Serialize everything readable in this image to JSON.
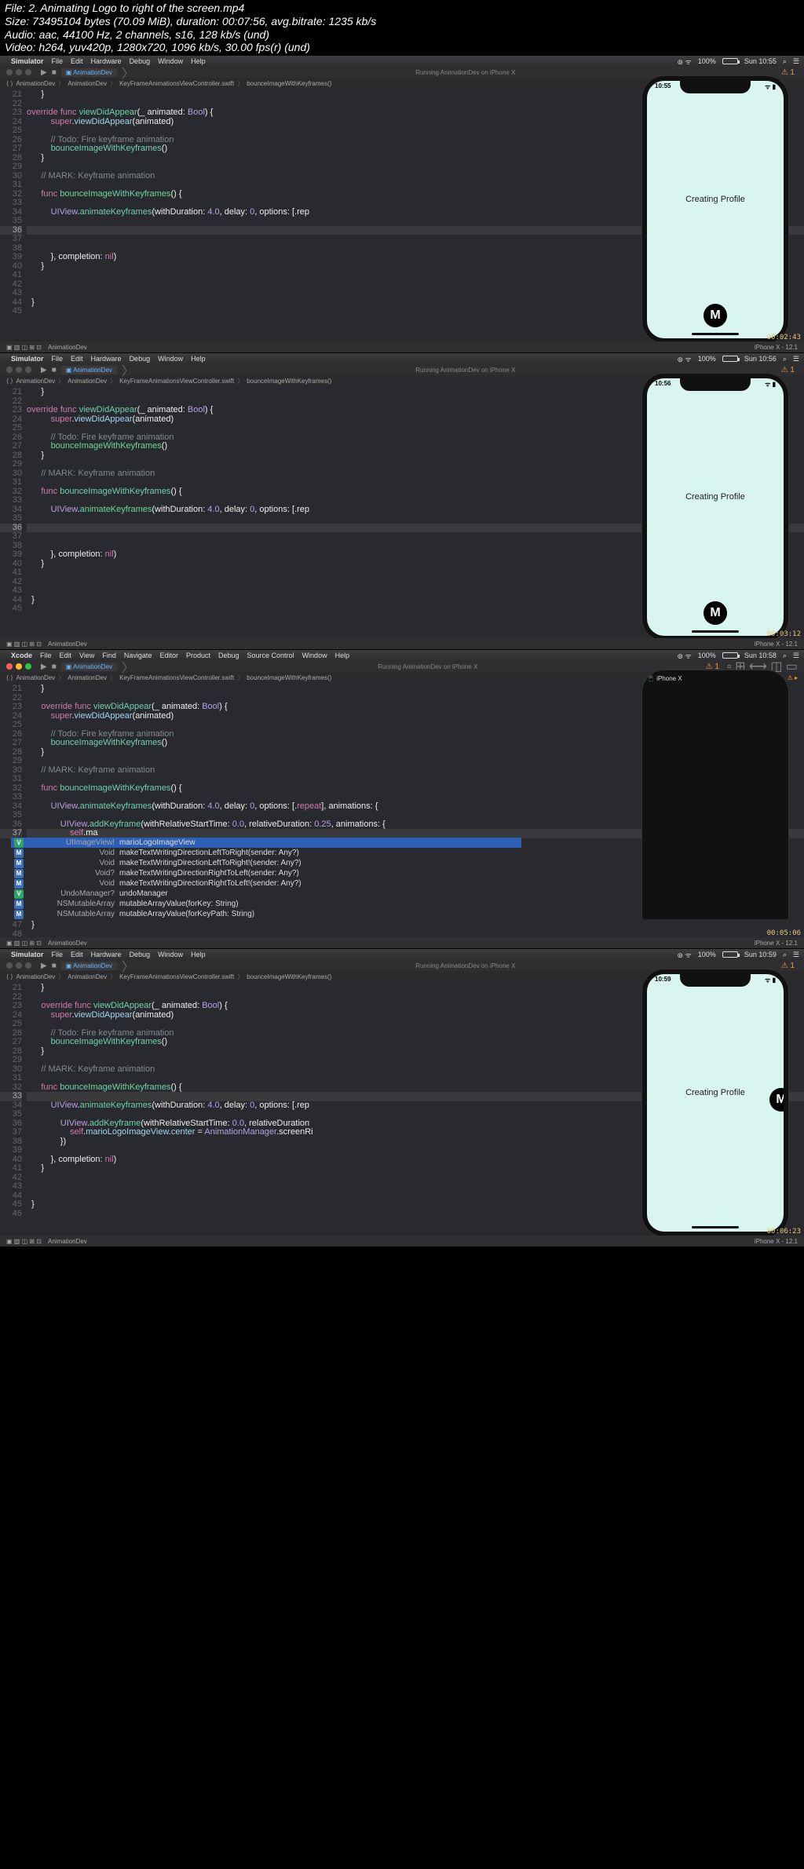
{
  "video_info": {
    "file": "File: 2. Animating Logo to right of the screen.mp4",
    "size": "Size: 73495104 bytes (70.09 MiB), duration: 00:07:56, avg.bitrate: 1235 kb/s",
    "audio": "Audio: aac, 44100 Hz, 2 channels, s16, 128 kb/s (und)",
    "video": "Video: h264, yuv420p, 1280x720, 1096 kb/s, 30.00 fps(r) (und)"
  },
  "menubar": {
    "app_sim": "Simulator",
    "app_xcode": "Xcode",
    "sim_items": [
      "File",
      "Edit",
      "Hardware",
      "Debug",
      "Window",
      "Help"
    ],
    "xcode_items": [
      "File",
      "Edit",
      "View",
      "Find",
      "Navigate",
      "Editor",
      "Product",
      "Debug",
      "Source Control",
      "Window",
      "Help"
    ],
    "battery": "100%",
    "day": "Sun"
  },
  "toolbar": {
    "scheme": "AnimationDev",
    "device": "iPhone X",
    "status": "Running AnimationDev on iPhone X"
  },
  "path": {
    "segs": [
      "AnimationDev",
      "AnimationDev",
      "KeyFrameAnimationsViewController.swift",
      "bounceImageWithKeyframes()"
    ]
  },
  "code_common": {
    "lines": [
      {
        "n": 21,
        "t": "      }"
      },
      {
        "n": 22,
        "t": ""
      },
      {
        "n": 23,
        "t": "      override func viewDidAppear(_ animated: Bool) {",
        "tok": [
          "kw:override",
          " ",
          "kw:func",
          " ",
          "fn:viewDidAppear",
          "pu:(",
          "id:_ animated: ",
          "ty:Bool",
          "pu:) {"
        ]
      },
      {
        "n": 24,
        "t": "          super.viewDidAppear(animated)",
        "tok": [
          "          ",
          "kw:super",
          "pu:.",
          "pr:viewDidAppear",
          "pu:(animated)"
        ]
      },
      {
        "n": 25,
        "t": ""
      },
      {
        "n": 26,
        "t": "          // Todo: Fire keyframe animation",
        "tok": [
          "          ",
          "cm:// Todo: Fire keyframe animation"
        ]
      },
      {
        "n": 27,
        "t": "          bounceImageWithKeyframes()",
        "tok": [
          "          ",
          "fn:bounceImageWithKeyframes",
          "pu:()"
        ]
      },
      {
        "n": 28,
        "t": "      }"
      },
      {
        "n": 29,
        "t": ""
      },
      {
        "n": 30,
        "t": "      // MARK: Keyframe animation",
        "tok": [
          "      ",
          "cm:// MARK: Keyframe animation"
        ]
      },
      {
        "n": 31,
        "t": ""
      },
      {
        "n": 32,
        "t": "      func bounceImageWithKeyframes() {",
        "tok": [
          "      ",
          "kw:func",
          " ",
          "fn:bounceImageWithKeyframes",
          "pu:() {"
        ]
      },
      {
        "n": 33,
        "t": ""
      },
      {
        "n": 34,
        "t": "          UIView.animateKeyframes(withDuration: 4.0, delay: 0, options: [.rep",
        "tok": [
          "          ",
          "ty:UIView",
          "pu:.",
          "fn:animateKeyframes",
          "pu:(withDuration: ",
          "nm:4.0",
          "pu:, delay: ",
          "nm:0",
          "pu:, options: [.",
          "id:rep"
        ]
      },
      {
        "n": 35,
        "t": ""
      },
      {
        "n": 36,
        "t": "",
        "hl": true
      },
      {
        "n": 37,
        "t": ""
      },
      {
        "n": 38,
        "t": ""
      },
      {
        "n": 39,
        "t": "          }, completion: nil)",
        "tok": [
          "          ",
          "pu:}, completion: ",
          "kw:nil",
          "pu:)"
        ]
      },
      {
        "n": 40,
        "t": "      }"
      },
      {
        "n": 41,
        "t": ""
      },
      {
        "n": 42,
        "t": ""
      },
      {
        "n": 43,
        "t": ""
      },
      {
        "n": 44,
        "t": "  }"
      },
      {
        "n": 45,
        "t": ""
      }
    ]
  },
  "code_frame3": {
    "lines": [
      {
        "n": 21,
        "t": "      }"
      },
      {
        "n": 22,
        "t": ""
      },
      {
        "n": 23,
        "tok": [
          "      ",
          "kw:override",
          " ",
          "kw:func",
          " ",
          "fn:viewDidAppear",
          "pu:(",
          "id:_ animated: ",
          "ty:Bool",
          "pu:) {"
        ]
      },
      {
        "n": 24,
        "tok": [
          "          ",
          "kw:super",
          "pu:.",
          "pr:viewDidAppear",
          "pu:(animated)"
        ]
      },
      {
        "n": 25,
        "t": ""
      },
      {
        "n": 26,
        "tok": [
          "          ",
          "cm:// Todo: Fire keyframe animation"
        ]
      },
      {
        "n": 27,
        "tok": [
          "          ",
          "fn:bounceImageWithKeyframes",
          "pu:()"
        ]
      },
      {
        "n": 28,
        "t": "      }"
      },
      {
        "n": 29,
        "t": ""
      },
      {
        "n": 30,
        "tok": [
          "      ",
          "cm:// MARK: Keyframe animation"
        ]
      },
      {
        "n": 31,
        "t": ""
      },
      {
        "n": 32,
        "tok": [
          "      ",
          "kw:func",
          " ",
          "fn:bounceImageWithKeyframes",
          "pu:() {"
        ]
      },
      {
        "n": 33,
        "t": ""
      },
      {
        "n": 34,
        "tok": [
          "          ",
          "ty:UIView",
          "pu:.",
          "fn:animateKeyframes",
          "pu:(withDuration: ",
          "nm:4.0",
          "pu:, delay: ",
          "nm:0",
          "pu:, options: [.",
          "kw:repeat",
          "pu:], animations: {"
        ]
      },
      {
        "n": 35,
        "t": ""
      },
      {
        "n": 36,
        "tok": [
          "              ",
          "ty:UIView",
          "pu:.",
          "fn:addKeyframe",
          "pu:(withRelativeStartTime: ",
          "nm:0.0",
          "pu:, relativeDuration: ",
          "nm:0.25",
          "pu:, animations: {"
        ]
      },
      {
        "n": 37,
        "tok": [
          "                  ",
          "kw:self",
          "pu:.",
          "id:ma"
        ],
        "hl": true
      }
    ]
  },
  "code_frame4": {
    "lines": [
      {
        "n": 21,
        "t": "      }"
      },
      {
        "n": 22,
        "t": ""
      },
      {
        "n": 23,
        "tok": [
          "      ",
          "kw:override",
          " ",
          "kw:func",
          " ",
          "fn:viewDidAppear",
          "pu:(",
          "id:_ animated: ",
          "ty:Bool",
          "pu:) {"
        ]
      },
      {
        "n": 24,
        "tok": [
          "          ",
          "kw:super",
          "pu:.",
          "pr:viewDidAppear",
          "pu:(animated)"
        ]
      },
      {
        "n": 25,
        "t": ""
      },
      {
        "n": 26,
        "tok": [
          "          ",
          "cm:// Todo: Fire keyframe animation"
        ]
      },
      {
        "n": 27,
        "tok": [
          "          ",
          "fn:bounceImageWithKeyframes",
          "pu:()"
        ]
      },
      {
        "n": 28,
        "t": "      }"
      },
      {
        "n": 29,
        "t": ""
      },
      {
        "n": 30,
        "tok": [
          "      ",
          "cm:// MARK: Keyframe animation"
        ]
      },
      {
        "n": 31,
        "t": ""
      },
      {
        "n": 32,
        "tok": [
          "      ",
          "kw:func",
          " ",
          "fn:bounceImageWithKeyframes",
          "pu:() {"
        ]
      },
      {
        "n": 33,
        "t": "",
        "hl": true
      },
      {
        "n": 34,
        "tok": [
          "          ",
          "ty:UIView",
          "pu:.",
          "fn:animateKeyframes",
          "pu:(withDuration: ",
          "nm:4.0",
          "pu:, delay: ",
          "nm:0",
          "pu:, options: [.",
          "id:rep"
        ]
      },
      {
        "n": 35,
        "t": ""
      },
      {
        "n": 36,
        "tok": [
          "              ",
          "ty:UIView",
          "pu:.",
          "fn:addKeyframe",
          "pu:(withRelativeStartTime: ",
          "nm:0.0",
          "pu:, relativeDuration"
        ]
      },
      {
        "n": 37,
        "tok": [
          "                  ",
          "kw:self",
          "pu:.",
          "pr:marioLogoImageView",
          "pu:.",
          "pr:center",
          "pu: = ",
          "ty:AnimationManager",
          "pu:.",
          "id:screenRi"
        ]
      },
      {
        "n": 38,
        "t": "              })"
      },
      {
        "n": 39,
        "t": ""
      },
      {
        "n": 40,
        "tok": [
          "          ",
          "pu:}, completion: ",
          "kw:nil",
          "pu:)"
        ]
      },
      {
        "n": 41,
        "t": "      }"
      },
      {
        "n": 42,
        "t": ""
      },
      {
        "n": 43,
        "t": ""
      },
      {
        "n": 44,
        "t": ""
      },
      {
        "n": 45,
        "t": "  }"
      },
      {
        "n": 46,
        "t": ""
      }
    ]
  },
  "autocomplete": {
    "items": [
      {
        "b": "V",
        "type": "UIImageView!",
        "text": "marioLogoImageView",
        "sel": true
      },
      {
        "b": "M",
        "type": "Void",
        "text": "makeTextWritingDirectionLeftToRight(sender: Any?)"
      },
      {
        "b": "M",
        "type": "Void",
        "text": "makeTextWritingDirectionLeftToRight!(sender: Any?)"
      },
      {
        "b": "M",
        "type": "Void?",
        "text": "makeTextWritingDirectionRightToLeft(sender: Any?)"
      },
      {
        "b": "M",
        "type": "Void",
        "text": "makeTextWritingDirectionRightToLeft!(sender: Any?)"
      },
      {
        "b": "V",
        "type": "UndoManager?",
        "text": "undoManager"
      },
      {
        "b": "M",
        "type": "NSMutableArray",
        "text": "mutableArrayValue(forKey: String)"
      },
      {
        "b": "M",
        "type": "NSMutableArray",
        "text": "mutableArrayValue(forKeyPath: String)"
      }
    ]
  },
  "frames": [
    {
      "time": "10:55",
      "ts": "00:02:43",
      "sim_label": "iPhone X - 12.1",
      "phone_text": "Creating Profile"
    },
    {
      "time": "10:56",
      "ts": "00:03:12",
      "sim_label": "iPhone X - 12.1",
      "phone_text": "Creating Profile"
    },
    {
      "time": "10:58",
      "ts": "00:05:06",
      "sim_label": "iPhone X - 12.1"
    },
    {
      "time": "10:59",
      "ts": "00:06:23",
      "sim_label": "iPhone X - 12.1",
      "phone_text": "Creating Profile"
    }
  ],
  "bottom": {
    "label": "AnimationDev"
  }
}
